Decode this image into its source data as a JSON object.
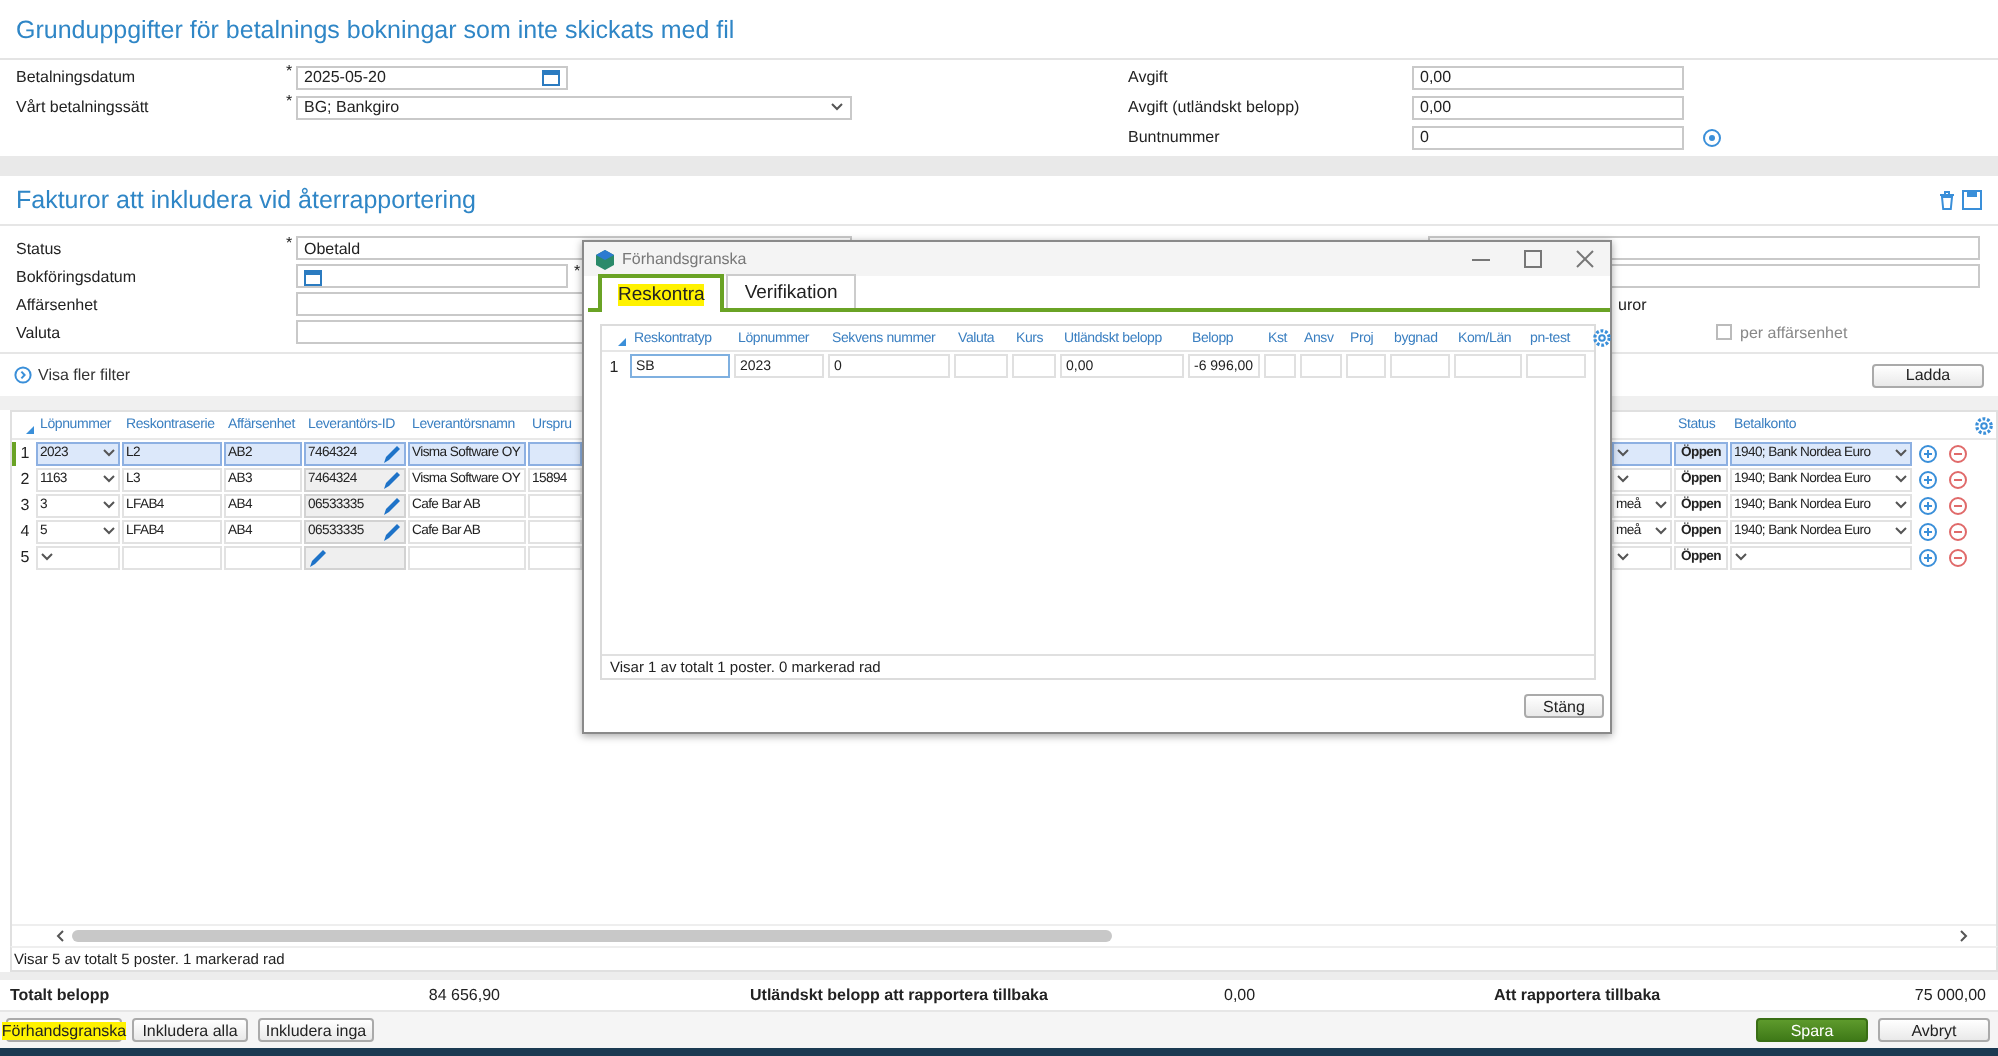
{
  "payment_basics": {
    "title": "Grunduppgifter för betalnings bokningar som inte skickats med fil",
    "left_fields": [
      {
        "label": "Betalningsdatum",
        "marker": "*",
        "kind": "date",
        "value": "2025-05-20"
      },
      {
        "label": "Vårt betalningssätt",
        "marker": "*",
        "kind": "select",
        "value": "BG; Bankgiro"
      }
    ],
    "right_fields": [
      {
        "label": "Avgift",
        "kind": "text",
        "value": "0,00"
      },
      {
        "label": "Avgift (utländskt belopp)",
        "kind": "text",
        "value": "0,00"
      },
      {
        "label": "Buntnummer",
        "kind": "text",
        "value": "0"
      }
    ]
  },
  "invoices": {
    "title": "Fakturor att inkludera vid återrapportering",
    "filters": [
      {
        "label": "Status",
        "marker": "*",
        "kind": "select",
        "value": "Obetald"
      },
      {
        "label": "Bokföringsdatum",
        "kind": "date",
        "suffix": "*"
      },
      {
        "label": "Affärsenhet",
        "kind": "text"
      },
      {
        "label": "Valuta",
        "kind": "text"
      }
    ],
    "right_filters": [
      {
        "kind": "select"
      },
      {
        "kind": "select"
      },
      {
        "kind": "label",
        "text": "uror"
      },
      {
        "kind": "checkbox",
        "label": "per affärsenhet",
        "checked": false
      }
    ],
    "more_filters_link": "Visa fler filter",
    "load_button": "Ladda",
    "grid": {
      "columns_left": [
        {
          "label": "Löpnummer",
          "kind": "select"
        },
        {
          "label": "Reskontraserie",
          "kind": "text"
        },
        {
          "label": "Affärsenhet",
          "kind": "text"
        },
        {
          "label": "Leverantörs-ID",
          "kind": "lookup"
        },
        {
          "label": "Leverantörsnamn",
          "kind": "text"
        },
        {
          "label": "Urspru",
          "kind": "text"
        }
      ],
      "columns_right": [
        {
          "kind": "select"
        },
        {
          "label": "Status",
          "kind": "status"
        },
        {
          "label": "Betalkonto",
          "kind": "select"
        }
      ],
      "rows": [
        {
          "number": "1",
          "selected": true,
          "lopnummer": "2023",
          "reskontraserie": "L2",
          "affarsenhet": "AB2",
          "leverantors_id": "7464324",
          "leverantorsnamn": "Visma Software OY",
          "status": "Öppen",
          "betalkonto": "1940; Bank Nordea Euro"
        },
        {
          "number": "2",
          "selected": false,
          "lopnummer": "1163",
          "reskontraserie": "L3",
          "affarsenhet": "AB3",
          "leverantors_id": "7464324",
          "leverantorsnamn": "Visma Software OY",
          "column_6": "15894",
          "status": "Öppen",
          "betalkonto": "1940; Bank Nordea Euro"
        },
        {
          "number": "3",
          "selected": false,
          "lopnummer": "3",
          "reskontraserie": "LFAB4",
          "affarsenhet": "AB4",
          "leverantors_id": "06533335",
          "leverantorsnamn": "Cafe Bar AB",
          "column_8": "meå",
          "status": "Öppen",
          "betalkonto": "1940; Bank Nordea Euro"
        },
        {
          "number": "4",
          "selected": false,
          "lopnummer": "5",
          "reskontraserie": "LFAB4",
          "affarsenhet": "AB4",
          "leverantors_id": "06533335",
          "leverantorsnamn": "Cafe Bar AB",
          "column_8": "meå",
          "status": "Öppen",
          "betalkonto": "1940; Bank Nordea Euro"
        },
        {
          "number": "5",
          "selected": false,
          "status": "Öppen"
        }
      ],
      "status": "Visar 5 av totalt 5 poster. 1 markerad rad"
    }
  },
  "totals": [
    {
      "label": "Totalt belopp",
      "value": "84 656,90"
    },
    {
      "label": "Utländskt belopp att rapportera tillbaka",
      "value": "0,00"
    },
    {
      "label": "Att rapportera tillbaka",
      "value": "75 000,00"
    }
  ],
  "left_buttons": [
    {
      "label": "Förhandsgranska",
      "highlighted": true
    },
    {
      "label": "Inkludera alla",
      "highlighted": false
    },
    {
      "label": "Inkludera inga",
      "highlighted": false
    }
  ],
  "right_buttons": [
    {
      "label": "Spara",
      "kind": "primary"
    },
    {
      "label": "Avbryt",
      "kind": "default"
    }
  ],
  "dialog": {
    "title": "Förhandsgranska",
    "tabs": [
      {
        "label": "Reskontra",
        "selected": true,
        "highlighted": true
      },
      {
        "label": "Verifikation",
        "selected": false,
        "highlighted": false
      }
    ],
    "columns": [
      "Reskontratyp",
      "Löpnummer",
      "Sekvens nummer",
      "Valuta",
      "Kurs",
      "Utländskt belopp",
      "Belopp",
      "Kst",
      "Ansv",
      "Proj",
      "bygnad",
      "Kom/Län",
      "pn-test"
    ],
    "rows": [
      {
        "number": "1",
        "reskontratyp": "SB",
        "lopnummer": "2023",
        "sekvens_nummer": "0",
        "utlandskt_belopp": "0,00",
        "belopp": "-6 996,00"
      }
    ],
    "status": "Visar 1 av totalt 1 poster. 0 markerad rad",
    "close_button": "Stäng"
  }
}
